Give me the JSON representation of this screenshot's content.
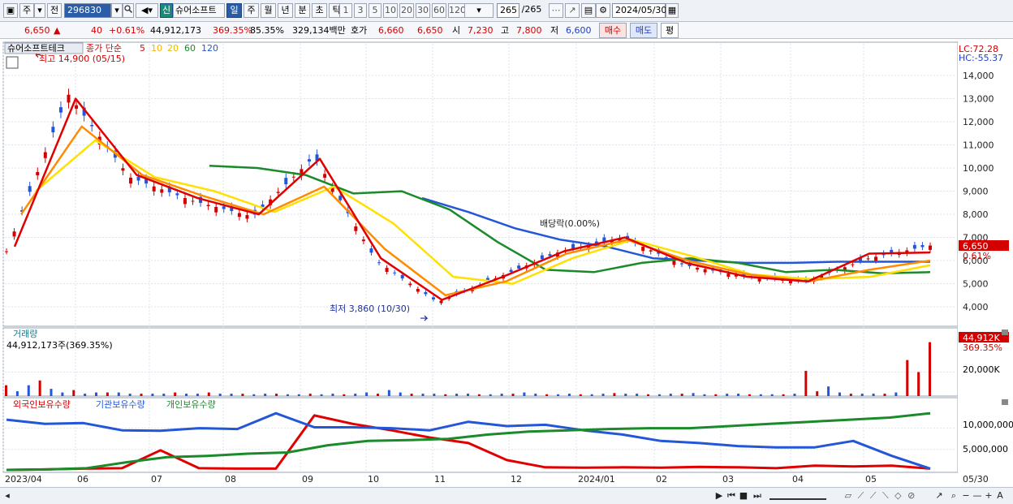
{
  "toolbar": {
    "period_main": "주",
    "jeon_label": "전",
    "code_value": "296830",
    "new_badge": "신",
    "stock_name": "슈어소프트",
    "periods": [
      "일",
      "주",
      "월",
      "년",
      "분",
      "초",
      "틱"
    ],
    "period_selected": "일",
    "intervals": [
      "1",
      "3",
      "5",
      "10",
      "20",
      "30",
      "60",
      "120"
    ],
    "count_display": "265",
    "count_total": "/265",
    "date_value": "2024/05/30"
  },
  "info": {
    "price": "6,650",
    "price_arrow": "▲",
    "change": "40",
    "change_pct": "+0.61%",
    "volume": "44,912,173",
    "volume_ratio": "369.35%",
    "turnover_ratio": "85.35%",
    "trade_value": "329,134백만",
    "hoga_label": "호가",
    "hoga_ask": "6,660",
    "hoga_bid": "6,650",
    "open_label": "시",
    "open": "7,230",
    "high_label": "고",
    "high": "7,800",
    "low_label": "저",
    "low": "6,600",
    "buy_label": "매수",
    "sell_label": "매도",
    "avg_label": "평"
  },
  "price_panel": {
    "name": "슈어소프트테크",
    "ma_label": "종가 단순",
    "ma_periods": [
      "5",
      "10",
      "20",
      "60",
      "120"
    ],
    "ma_colors": [
      "#e00000",
      "#ff8c00",
      "#ffe000",
      "#1a8a2a",
      "#2456d8"
    ],
    "high_annotation": "최고 14,900 (05/15)",
    "low_annotation": "최저 3,860 (10/30)",
    "dividend_annotation": "배당락(0.00%)",
    "lc_label": "LC:72.28",
    "hc_label": "HC:-55.37",
    "current_price_tag": "6,650",
    "current_pct_tag": "0.61%"
  },
  "volume_panel": {
    "title": "거래량",
    "value_text": "44,912,173주(369.35%)",
    "tag_value": "44,912K",
    "tag_pct": "369.35%",
    "axis_label": "20,000K"
  },
  "holdings_panel": {
    "legends": [
      "외국인보유수량",
      "기관보유수량",
      "개인보유수량"
    ],
    "legend_colors": [
      "#e00000",
      "#2456d8",
      "#1a8a2a"
    ],
    "axis_labels": [
      "10,000,000",
      "5,000,000"
    ]
  },
  "x_axis": {
    "labels": [
      "2023/04",
      "06",
      "07",
      "08",
      "09",
      "10",
      "11",
      "12",
      "2024/01",
      "02",
      "03",
      "04",
      "05",
      "05/30"
    ]
  },
  "chart_data": [
    {
      "type": "line",
      "name": "price",
      "y_ticks": [
        4000,
        5000,
        6000,
        7000,
        8000,
        9000,
        10000,
        11000,
        12000,
        13000,
        14000
      ],
      "ylim": [
        3300,
        15300
      ],
      "x": [
        "2023/04",
        "06",
        "07",
        "08",
        "09",
        "10",
        "11",
        "12",
        "2024/01",
        "02",
        "03",
        "04",
        "05",
        "05/30"
      ],
      "close": [
        6400,
        13200,
        9600,
        8600,
        7900,
        10500,
        6000,
        4200,
        5300,
        6400,
        7000,
        5800,
        5300,
        5100,
        6100,
        6650
      ],
      "ma5": [
        6600,
        13000,
        9700,
        8700,
        8000,
        10400,
        6100,
        4300,
        5300,
        6400,
        7000,
        5900,
        5300,
        5100,
        6300,
        6350
      ],
      "ma10": [
        8000,
        11800,
        9700,
        8800,
        8000,
        9200,
        6500,
        4500,
        5100,
        6300,
        6900,
        6000,
        5400,
        5100,
        5600,
        6000
      ],
      "ma20": [
        9000,
        11200,
        9600,
        9000,
        8100,
        9200,
        7600,
        5300,
        5000,
        6100,
        6900,
        6200,
        5400,
        5200,
        5300,
        5800
      ],
      "ma60": [
        10100,
        10000,
        9700,
        8900,
        9000,
        8200,
        6800,
        5600,
        5500,
        5900,
        6100,
        5900,
        5500,
        5600,
        5450,
        5500
      ],
      "ma120": [
        8700,
        8100,
        7400,
        6900,
        6600,
        6100,
        6000,
        5900,
        5900,
        5950,
        5950,
        5950
      ],
      "high_point": {
        "date": "05/15",
        "value": 14900
      },
      "low_point": {
        "date": "10/30",
        "value": 3860
      }
    },
    {
      "type": "bar",
      "name": "volume",
      "y_ticks": [
        20000
      ],
      "ylim": [
        0,
        46000
      ],
      "values_k": [
        9000,
        4000,
        9000,
        13000,
        6000,
        3000,
        5000,
        2000,
        3000,
        3000,
        3000,
        2000,
        2000,
        2000,
        2000,
        3000,
        2000,
        2000,
        3000,
        2000,
        2000,
        2000,
        1500,
        2000,
        2000,
        1500,
        1500,
        2000,
        1500,
        2000,
        1500,
        2000,
        3000,
        2000,
        5000,
        3000,
        2000,
        2000,
        2000,
        1500,
        2000,
        2000,
        1500,
        1500,
        2000,
        2000,
        3000,
        2000,
        1500,
        1500,
        2000,
        1500,
        1500,
        2000,
        2500,
        2000,
        2000,
        1500,
        1500,
        2000,
        2000,
        2500,
        1500,
        1500,
        2000,
        2000,
        1500,
        1500,
        1500,
        1500,
        2000,
        21000,
        4000,
        8000,
        3000,
        2000,
        2000,
        2000,
        2000,
        3000,
        30000,
        20000,
        44912
      ]
    },
    {
      "type": "line",
      "name": "holdings",
      "y_ticks": [
        5000000,
        10000000
      ],
      "ylim": [
        0,
        14500000
      ],
      "series": [
        {
          "name": "외국인보유수량",
          "color": "#e00000",
          "values": [
            200000,
            300000,
            500000,
            600000,
            4800000,
            600000,
            500000,
            500000,
            13000000,
            11000000,
            9500000,
            7800000,
            6500000,
            2500000,
            800000,
            700000,
            800000,
            700000,
            900000,
            800000,
            600000,
            1200000,
            1000000,
            1200000,
            500000
          ]
        },
        {
          "name": "기관보유수량",
          "color": "#2456d8",
          "values": [
            12000000,
            11000000,
            11200000,
            9500000,
            9400000,
            10000000,
            9800000,
            13500000,
            10200000,
            10200000,
            10000000,
            9500000,
            11500000,
            10500000,
            10800000,
            9500000,
            8500000,
            7000000,
            6500000,
            5800000,
            5500000,
            5500000,
            7000000,
            3500000,
            500000
          ]
        },
        {
          "name": "개인보유수량",
          "color": "#1a8a2a",
          "values": [
            200000,
            300000,
            600000,
            2000000,
            3200000,
            3500000,
            4000000,
            4300000,
            6000000,
            7000000,
            7200000,
            7500000,
            8500000,
            9200000,
            9500000,
            9800000,
            10000000,
            10000000,
            10500000,
            11000000,
            11500000,
            12000000,
            12500000,
            13500000
          ]
        }
      ]
    }
  ]
}
